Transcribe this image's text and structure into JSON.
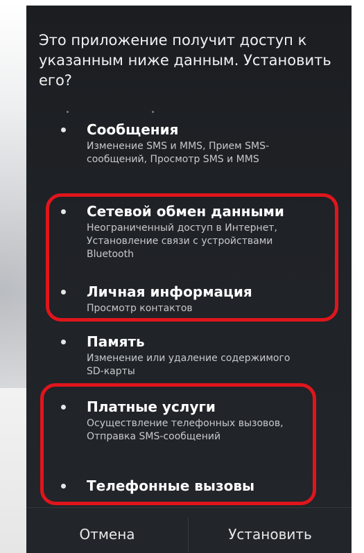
{
  "dialog": {
    "message": "Это приложение получит доступ к указанным ниже данным. Установить его?"
  },
  "permissions": [
    {
      "title": "Сообщения",
      "description": "Изменение SMS и MMS, Прием SMS-сообщений, Просмотр SMS и MMS"
    },
    {
      "title": "Сетевой обмен данными",
      "description": "Неограниченный доступ в Интернет, Установление связи с устройствами Bluetooth"
    },
    {
      "title": "Личная информация",
      "description": "Просмотр контактов"
    },
    {
      "title": "Память",
      "description": "Изменение или удаление содержимого SD-карты"
    },
    {
      "title": "Платные услуги",
      "description": "Осуществление телефонных вызовов, Отправка SMS-сообщений"
    },
    {
      "title": "Телефонные вызовы",
      "description": ""
    }
  ],
  "buttons": {
    "cancel_label": "Отмена",
    "install_label": "Установить"
  },
  "colors": {
    "dialog_background": "#1f2226",
    "highlight_outline": "#e0151c",
    "title_text": "#ffffff",
    "description_text": "#c7c9cc"
  }
}
